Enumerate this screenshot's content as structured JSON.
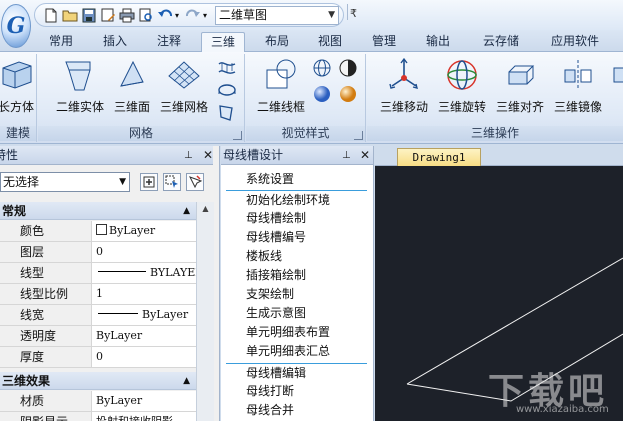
{
  "app": {
    "logo_letter": "G"
  },
  "quick_access": {
    "workspace": "二维草图",
    "more_glyph": "₹"
  },
  "tabs": [
    "常用",
    "插入",
    "注释",
    "三维",
    "布局",
    "视图",
    "管理",
    "输出",
    "云存储",
    "应用软件"
  ],
  "active_tab": "三维",
  "ribbon": {
    "groups": [
      {
        "title": "建模",
        "buttons": [
          "长方体"
        ]
      },
      {
        "title": "网格",
        "buttons": [
          "二维实体",
          "三维面",
          "三维网格"
        ]
      },
      {
        "title": "视觉样式",
        "buttons": [
          "二维线框"
        ]
      },
      {
        "title": "三维操作",
        "buttons": [
          "三维移动",
          "三维旋转",
          "三维对齐",
          "三维镜像"
        ]
      }
    ]
  },
  "properties_panel": {
    "title": "特性",
    "selection": "无选择",
    "sections": [
      {
        "title": "常规",
        "rows": [
          {
            "key": "颜色",
            "value": "ByLayer"
          },
          {
            "key": "图层",
            "value": "0"
          },
          {
            "key": "线型",
            "value": "BYLAYER"
          },
          {
            "key": "线型比例",
            "value": "1"
          },
          {
            "key": "线宽",
            "value": "ByLayer"
          },
          {
            "key": "透明度",
            "value": "ByLayer"
          },
          {
            "key": "厚度",
            "value": "0"
          }
        ]
      },
      {
        "title": "三维效果",
        "rows": [
          {
            "key": "材质",
            "value": "ByLayer"
          },
          {
            "key": "阴影显示",
            "value": "投射和接收阴影"
          }
        ]
      }
    ]
  },
  "busbar_panel": {
    "title": "母线槽设计",
    "items": [
      "系统设置",
      "初始化绘制环境",
      "母线槽绘制",
      "母线槽编号",
      "楼板线",
      "插接箱绘制",
      "支架绘制",
      "生成示意图",
      "单元明细表布置",
      "单元明细表汇总",
      "母线槽编辑",
      "母线打断",
      "母线合并"
    ]
  },
  "drawing": {
    "tab": "Drawing1"
  },
  "watermark": {
    "text": "下载吧",
    "url": "www.xiazaiba.com"
  },
  "colors": {
    "accent": "#3a9ddc",
    "canvas": "#1d2129",
    "tab_active": "#f7dd84"
  }
}
